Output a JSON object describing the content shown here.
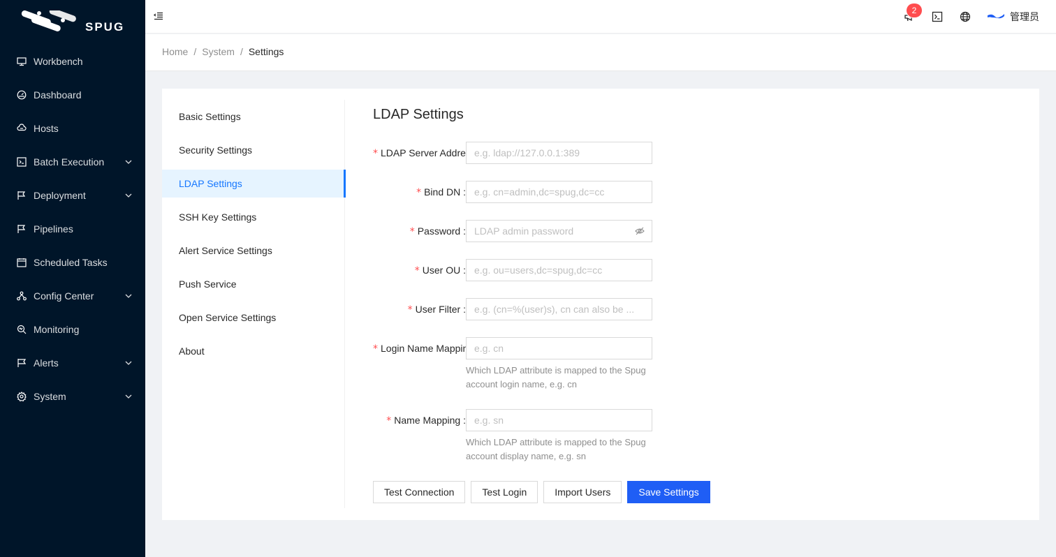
{
  "brand": {
    "name": "SPUG"
  },
  "sidebar": {
    "items": [
      {
        "label": "Workbench",
        "icon": "desktop-icon",
        "has_submenu": false
      },
      {
        "label": "Dashboard",
        "icon": "dashboard-icon",
        "has_submenu": false
      },
      {
        "label": "Hosts",
        "icon": "cloud-server-icon",
        "has_submenu": false
      },
      {
        "label": "Batch Execution",
        "icon": "code-icon",
        "has_submenu": true
      },
      {
        "label": "Deployment",
        "icon": "flag-icon",
        "has_submenu": true
      },
      {
        "label": "Pipelines",
        "icon": "flag-icon",
        "has_submenu": false
      },
      {
        "label": "Scheduled Tasks",
        "icon": "schedule-icon",
        "has_submenu": false
      },
      {
        "label": "Config Center",
        "icon": "deployment-unit-icon",
        "has_submenu": true
      },
      {
        "label": "Monitoring",
        "icon": "monitor-icon",
        "has_submenu": false
      },
      {
        "label": "Alerts",
        "icon": "alert-icon",
        "has_submenu": true
      },
      {
        "label": "System",
        "icon": "setting-icon",
        "has_submenu": true
      }
    ]
  },
  "header": {
    "notification_count": "2",
    "user_name": "管理员"
  },
  "breadcrumb": [
    "Home",
    "System",
    "Settings"
  ],
  "settings_nav": {
    "items": [
      "Basic Settings",
      "Security Settings",
      "LDAP Settings",
      "SSH Key Settings",
      "Alert Service Settings",
      "Push Service",
      "Open Service Settings",
      "About"
    ],
    "active": "LDAP Settings"
  },
  "form": {
    "title": "LDAP Settings",
    "fields": [
      {
        "label": "LDAP Server Address",
        "placeholder": "e.g. ldap://127.0.0.1:389",
        "value": "",
        "help": ""
      },
      {
        "label": "Bind DN",
        "placeholder": "e.g. cn=admin,dc=spug,dc=cc",
        "value": "",
        "help": ""
      },
      {
        "label": "Password",
        "placeholder": "LDAP admin password",
        "value": "",
        "help": ""
      },
      {
        "label": "User OU",
        "placeholder": "e.g. ou=users,dc=spug,dc=cc",
        "value": "",
        "help": ""
      },
      {
        "label": "User Filter",
        "placeholder": "e.g. (cn=%(user)s), cn can also be ...",
        "value": "",
        "help": ""
      },
      {
        "label": "Login Name Mapping",
        "placeholder": "e.g. cn",
        "value": "",
        "help": "Which LDAP attribute is mapped to the Spug account login name, e.g. cn"
      },
      {
        "label": "Name Mapping",
        "placeholder": "e.g. sn",
        "value": "",
        "help": "Which LDAP attribute is mapped to the Spug account display name, e.g. sn"
      }
    ],
    "buttons": {
      "test_connection": "Test Connection",
      "test_login": "Test Login",
      "import_users": "Import Users",
      "save": "Save Settings"
    }
  },
  "colors": {
    "sidebar_bg": "#001529",
    "primary": "#1f5ef5",
    "active_text": "#1677ff",
    "active_bg": "#e6f4ff",
    "required": "#ff4d4f",
    "badge": "#ff4d4f"
  }
}
